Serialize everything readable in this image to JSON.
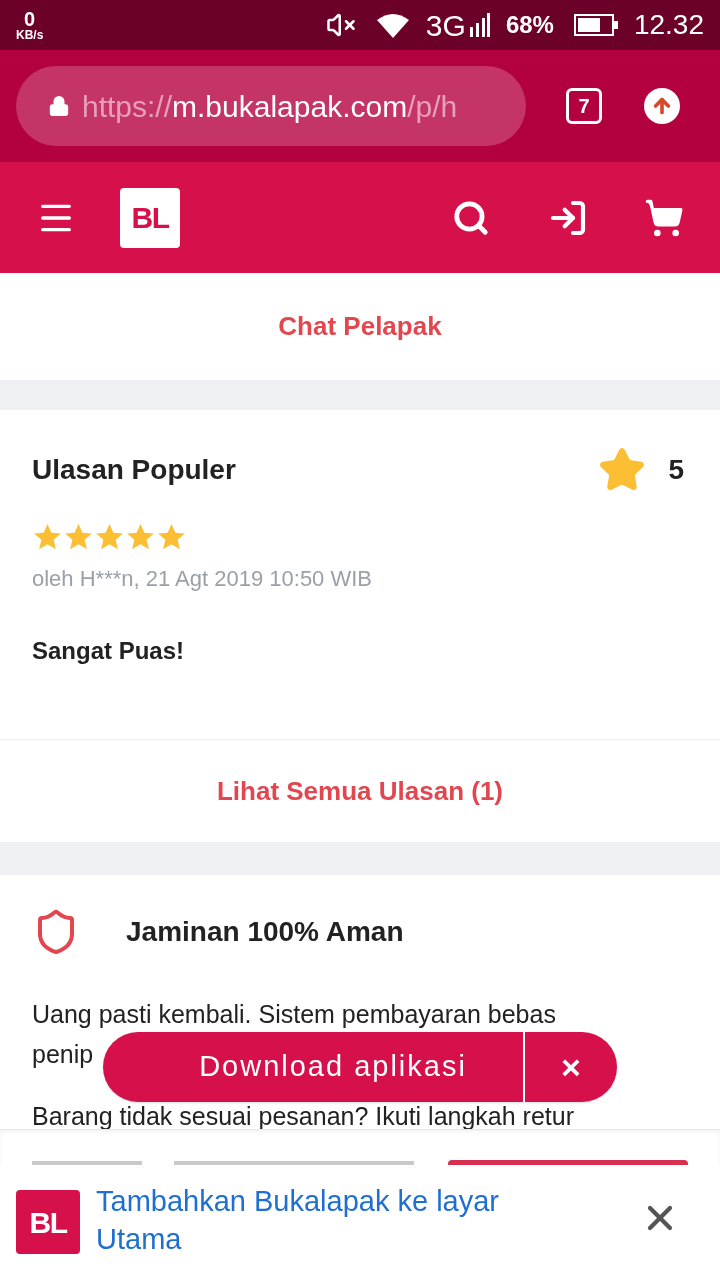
{
  "status_bar": {
    "speed_value": "0",
    "speed_unit": "KB/s",
    "network": "3G",
    "battery": "68%",
    "time": "12.32"
  },
  "browser": {
    "url_scheme": "https://",
    "url_host": "m.bukalapak.com",
    "url_path": "/p/h",
    "tab_count": "7"
  },
  "header": {
    "logo": "BL"
  },
  "chat_link": "Chat Pelapak",
  "reviews": {
    "title": "Ulasan Populer",
    "rating": "5",
    "review": {
      "stars": 5,
      "meta": "oleh H***n, 21 Agt 2019 10:50 WIB",
      "text": "Sangat Puas!"
    },
    "see_all": "Lihat Semua Ulasan (1)"
  },
  "guarantee": {
    "title": "Jaminan 100% Aman",
    "paragraphs": [
      "Uang pasti kembali. Sistem pembayaran bebas",
      "penip",
      "Barang tidak sesuai pesanan? Ikuti langkah retur"
    ]
  },
  "download_prompt": {
    "label": "Download aplikasi",
    "close": "×"
  },
  "install_banner": {
    "logo": "BL",
    "text": "Tambahkan Bukalapak ke layar Utama"
  }
}
